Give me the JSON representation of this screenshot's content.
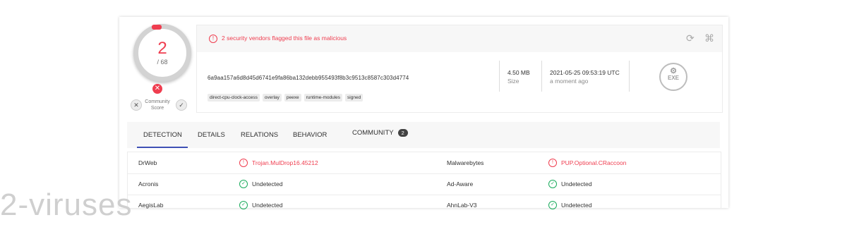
{
  "score": {
    "detections": "2",
    "total": "/ 68"
  },
  "community": {
    "label_line1": "Community",
    "label_line2": "Score",
    "down_icon": "x",
    "up_icon": "check"
  },
  "alert": {
    "text": "2 security vendors flagged this file as malicious",
    "icon": "!"
  },
  "file": {
    "hash": "6a9aa157a6d8d45d6741e9fa86ba132debb955493f8b3c9513c8587c303d4774",
    "tags": [
      "direct-cpu-clock-access",
      "overlay",
      "peexe",
      "runtime-modules",
      "signed"
    ],
    "size_value": "4.50 MB",
    "size_label": "Size",
    "date_value": "2021-05-25 09:53:19 UTC",
    "date_label": "a moment ago",
    "type": "EXE"
  },
  "tabs": [
    {
      "label": "DETECTION"
    },
    {
      "label": "DETAILS"
    },
    {
      "label": "RELATIONS"
    },
    {
      "label": "BEHAVIOR"
    },
    {
      "label": "COMMUNITY",
      "badge": "2"
    }
  ],
  "detections": [
    {
      "left_vendor": "DrWeb",
      "left_result": "Trojan.MulDrop16.45212",
      "left_status": "malicious",
      "right_vendor": "Malwarebytes",
      "right_result": "PUP.Optional.CRaccoon",
      "right_status": "malicious"
    },
    {
      "left_vendor": "Acronis",
      "left_result": "Undetected",
      "left_status": "clean",
      "right_vendor": "Ad-Aware",
      "right_result": "Undetected",
      "right_status": "clean"
    },
    {
      "left_vendor": "AegisLab",
      "left_result": "Undetected",
      "left_status": "clean",
      "right_vendor": "AhnLab-V3",
      "right_result": "Undetected",
      "right_status": "clean"
    }
  ],
  "watermark": "2-viruses",
  "colors": {
    "malicious": "#ef3d4f",
    "clean": "#1aab5c",
    "accent": "#3f51b5"
  }
}
